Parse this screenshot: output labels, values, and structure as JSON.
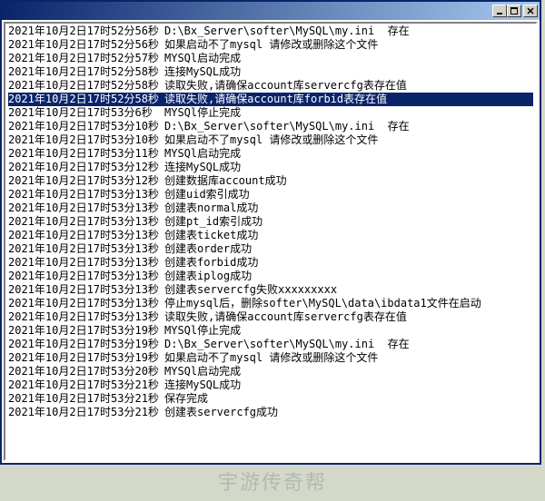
{
  "window": {
    "titlebar": {
      "minimize_icon": "minimize-icon",
      "maximize_icon": "maximize-icon",
      "close_icon": "close-icon"
    }
  },
  "log": {
    "selected_index": 5,
    "rows": [
      {
        "ts": "2021年10月2日17时52分56秒",
        "msg": "D:\\Bx_Server\\softer\\MySQL\\my.ini  存在"
      },
      {
        "ts": "2021年10月2日17时52分56秒",
        "msg": "如果启动不了mysql 请修改或删除这个文件"
      },
      {
        "ts": "2021年10月2日17时52分57秒",
        "msg": "MYSQl启动完成"
      },
      {
        "ts": "2021年10月2日17时52分58秒",
        "msg": "连接MySQL成功"
      },
      {
        "ts": "2021年10月2日17时52分58秒",
        "msg": "读取失败,请确保account库servercfg表存在值"
      },
      {
        "ts": "2021年10月2日17时52分58秒",
        "msg": "读取失败,请确保account库forbid表存在值"
      },
      {
        "ts": "2021年10月2日17时53分6秒",
        "msg": "MYSQl停止完成"
      },
      {
        "ts": "2021年10月2日17时53分10秒",
        "msg": "D:\\Bx_Server\\softer\\MySQL\\my.ini  存在"
      },
      {
        "ts": "2021年10月2日17时53分10秒",
        "msg": "如果启动不了mysql 请修改或删除这个文件"
      },
      {
        "ts": "2021年10月2日17时53分11秒",
        "msg": "MYSQl启动完成"
      },
      {
        "ts": "2021年10月2日17时53分12秒",
        "msg": "连接MySQL成功"
      },
      {
        "ts": "2021年10月2日17时53分12秒",
        "msg": "创建数据库account成功"
      },
      {
        "ts": "2021年10月2日17时53分13秒",
        "msg": "创建uid索引成功"
      },
      {
        "ts": "2021年10月2日17时53分13秒",
        "msg": "创建表normal成功"
      },
      {
        "ts": "2021年10月2日17时53分13秒",
        "msg": "创建pt_id索引成功"
      },
      {
        "ts": "2021年10月2日17时53分13秒",
        "msg": "创建表ticket成功"
      },
      {
        "ts": "2021年10月2日17时53分13秒",
        "msg": "创建表order成功"
      },
      {
        "ts": "2021年10月2日17时53分13秒",
        "msg": "创建表forbid成功"
      },
      {
        "ts": "2021年10月2日17时53分13秒",
        "msg": "创建表iplog成功"
      },
      {
        "ts": "2021年10月2日17时53分13秒",
        "msg": "创建表servercfg失败xxxxxxxxx"
      },
      {
        "ts": "2021年10月2日17时53分13秒",
        "msg": "停止mysql后，删除softer\\MySQL\\data\\ibdata1文件在启动"
      },
      {
        "ts": "2021年10月2日17时53分13秒",
        "msg": "读取失败,请确保account库servercfg表存在值"
      },
      {
        "ts": "2021年10月2日17时53分19秒",
        "msg": "MYSQl停止完成"
      },
      {
        "ts": "2021年10月2日17时53分19秒",
        "msg": "D:\\Bx_Server\\softer\\MySQL\\my.ini  存在"
      },
      {
        "ts": "2021年10月2日17时53分19秒",
        "msg": "如果启动不了mysql 请修改或删除这个文件"
      },
      {
        "ts": "2021年10月2日17时53分20秒",
        "msg": "MYSQl启动完成"
      },
      {
        "ts": "2021年10月2日17时53分21秒",
        "msg": "连接MySQL成功"
      },
      {
        "ts": "2021年10月2日17时53分21秒",
        "msg": "保存完成"
      },
      {
        "ts": "2021年10月2日17时53分21秒",
        "msg": "创建表servercfg成功"
      }
    ]
  },
  "watermark": {
    "text": "宇游传奇帮"
  }
}
